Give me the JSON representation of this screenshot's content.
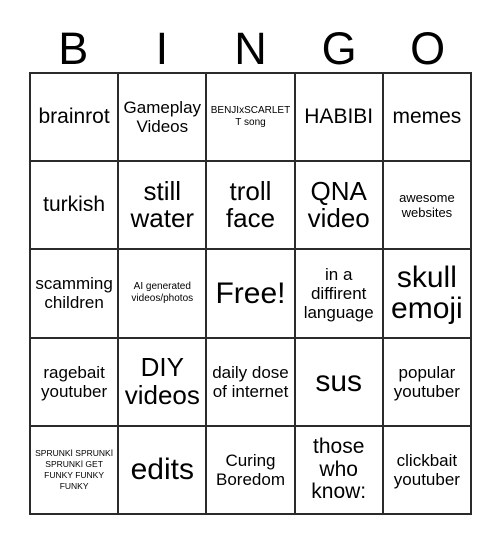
{
  "card": {
    "title": "BINGO",
    "header_letters": [
      "B",
      "I",
      "N",
      "G",
      "O"
    ],
    "columns": 5,
    "rows": 5,
    "colors": {
      "background": "#ffffff",
      "text": "#000000",
      "grid_line": "#2b2b2b"
    },
    "cells": [
      [
        {
          "text": "brainrot",
          "size": "l"
        },
        {
          "text": "Gameplay Videos",
          "size": "m"
        },
        {
          "text": "BENJIxSCARLETT song",
          "size": "xs"
        },
        {
          "text": "HABIBI",
          "size": "l"
        },
        {
          "text": "memes",
          "size": "l"
        }
      ],
      [
        {
          "text": "turkish",
          "size": "l"
        },
        {
          "text": "still water",
          "size": "xl"
        },
        {
          "text": "troll face",
          "size": "xl"
        },
        {
          "text": "QNA video",
          "size": "xl"
        },
        {
          "text": "awesome websites",
          "size": "s"
        }
      ],
      [
        {
          "text": "scamming children",
          "size": "m"
        },
        {
          "text": "AI generated videos/photos",
          "size": "xs"
        },
        {
          "text": "Free!",
          "size": "xxl"
        },
        {
          "text": "in a diffirent language",
          "size": "m"
        },
        {
          "text": "skull emoji",
          "size": "xxl"
        }
      ],
      [
        {
          "text": "ragebait youtuber",
          "size": "m"
        },
        {
          "text": "DIY videos",
          "size": "xl"
        },
        {
          "text": "daily dose of internet",
          "size": "m"
        },
        {
          "text": "sus",
          "size": "xxl"
        },
        {
          "text": "popular youtuber",
          "size": "m"
        }
      ],
      [
        {
          "text": "SPRUNKİ SPRUNKİ SPRUNKİ GET FUNKY FUNKY FUNKY",
          "size": "xxs"
        },
        {
          "text": "edits",
          "size": "xxl"
        },
        {
          "text": "Curing Boredom",
          "size": "m"
        },
        {
          "text": "those who know:",
          "size": "l"
        },
        {
          "text": "clickbait youtuber",
          "size": "m"
        }
      ]
    ]
  }
}
